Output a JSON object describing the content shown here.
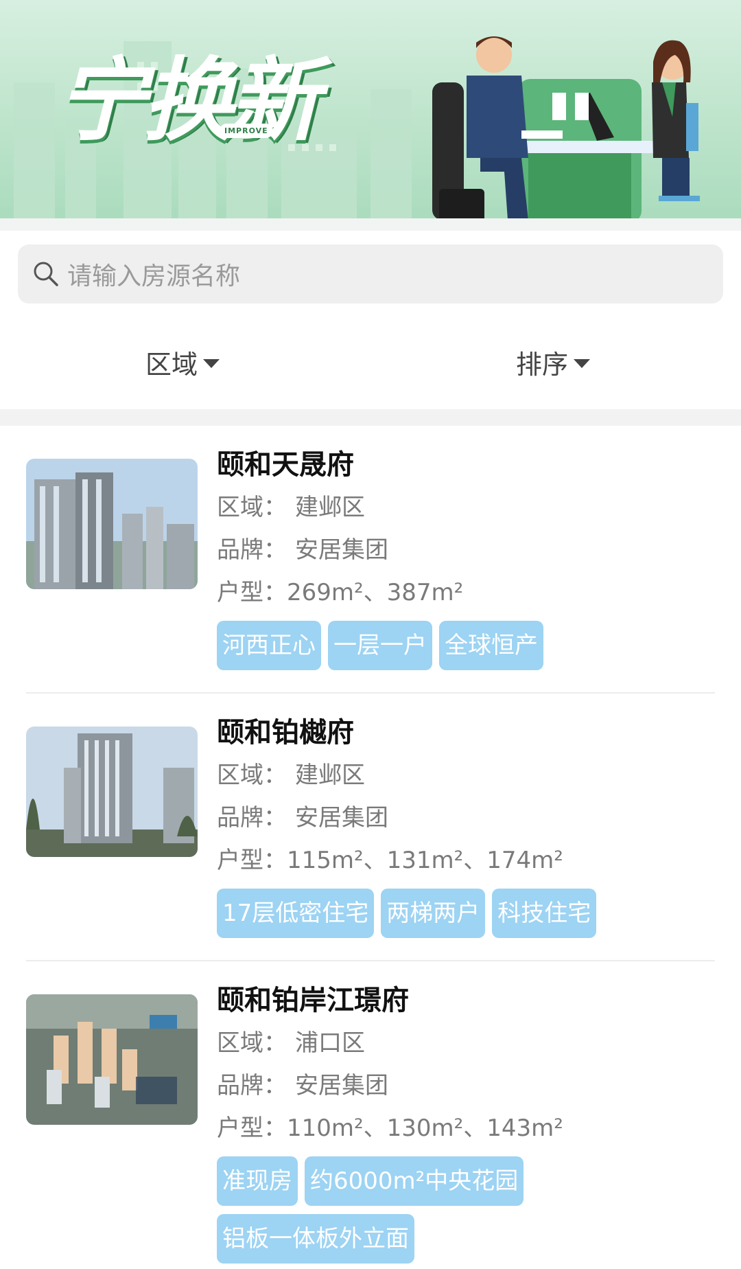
{
  "banner": {
    "logo_text": "宁换新",
    "logo_sub": "IMPROVE"
  },
  "search": {
    "placeholder": "请输入房源名称"
  },
  "filters": {
    "region_label": "区域",
    "sort_label": "排序"
  },
  "colors": {
    "tag_bg": "#9dd3f3",
    "banner_green": "#a9dbbc",
    "logo_shadow": "#2f7f49"
  },
  "listings": [
    {
      "name": "颐和天晟府",
      "region_label": "区域：",
      "region": "建邺区",
      "brand_label": "品牌：",
      "brand": "安居集团",
      "layout_label": "户型：",
      "layout": "269m²、387m²",
      "tags": [
        "河西正心",
        "一层一户",
        "全球恒产"
      ]
    },
    {
      "name": "颐和铂樾府",
      "region_label": "区域：",
      "region": "建邺区",
      "brand_label": "品牌：",
      "brand": "安居集团",
      "layout_label": "户型：",
      "layout": "115m²、131m²、174m²",
      "tags": [
        "17层低密住宅",
        "两梯两户",
        "科技住宅"
      ]
    },
    {
      "name": "颐和铂岸江璟府",
      "region_label": "区域：",
      "region": "浦口区",
      "brand_label": "品牌：",
      "brand": "安居集团",
      "layout_label": "户型：",
      "layout": "110m²、130m²、143m²",
      "tags": [
        "准现房",
        "约6000m²中央花园",
        "铝板一体板外立面"
      ]
    }
  ]
}
